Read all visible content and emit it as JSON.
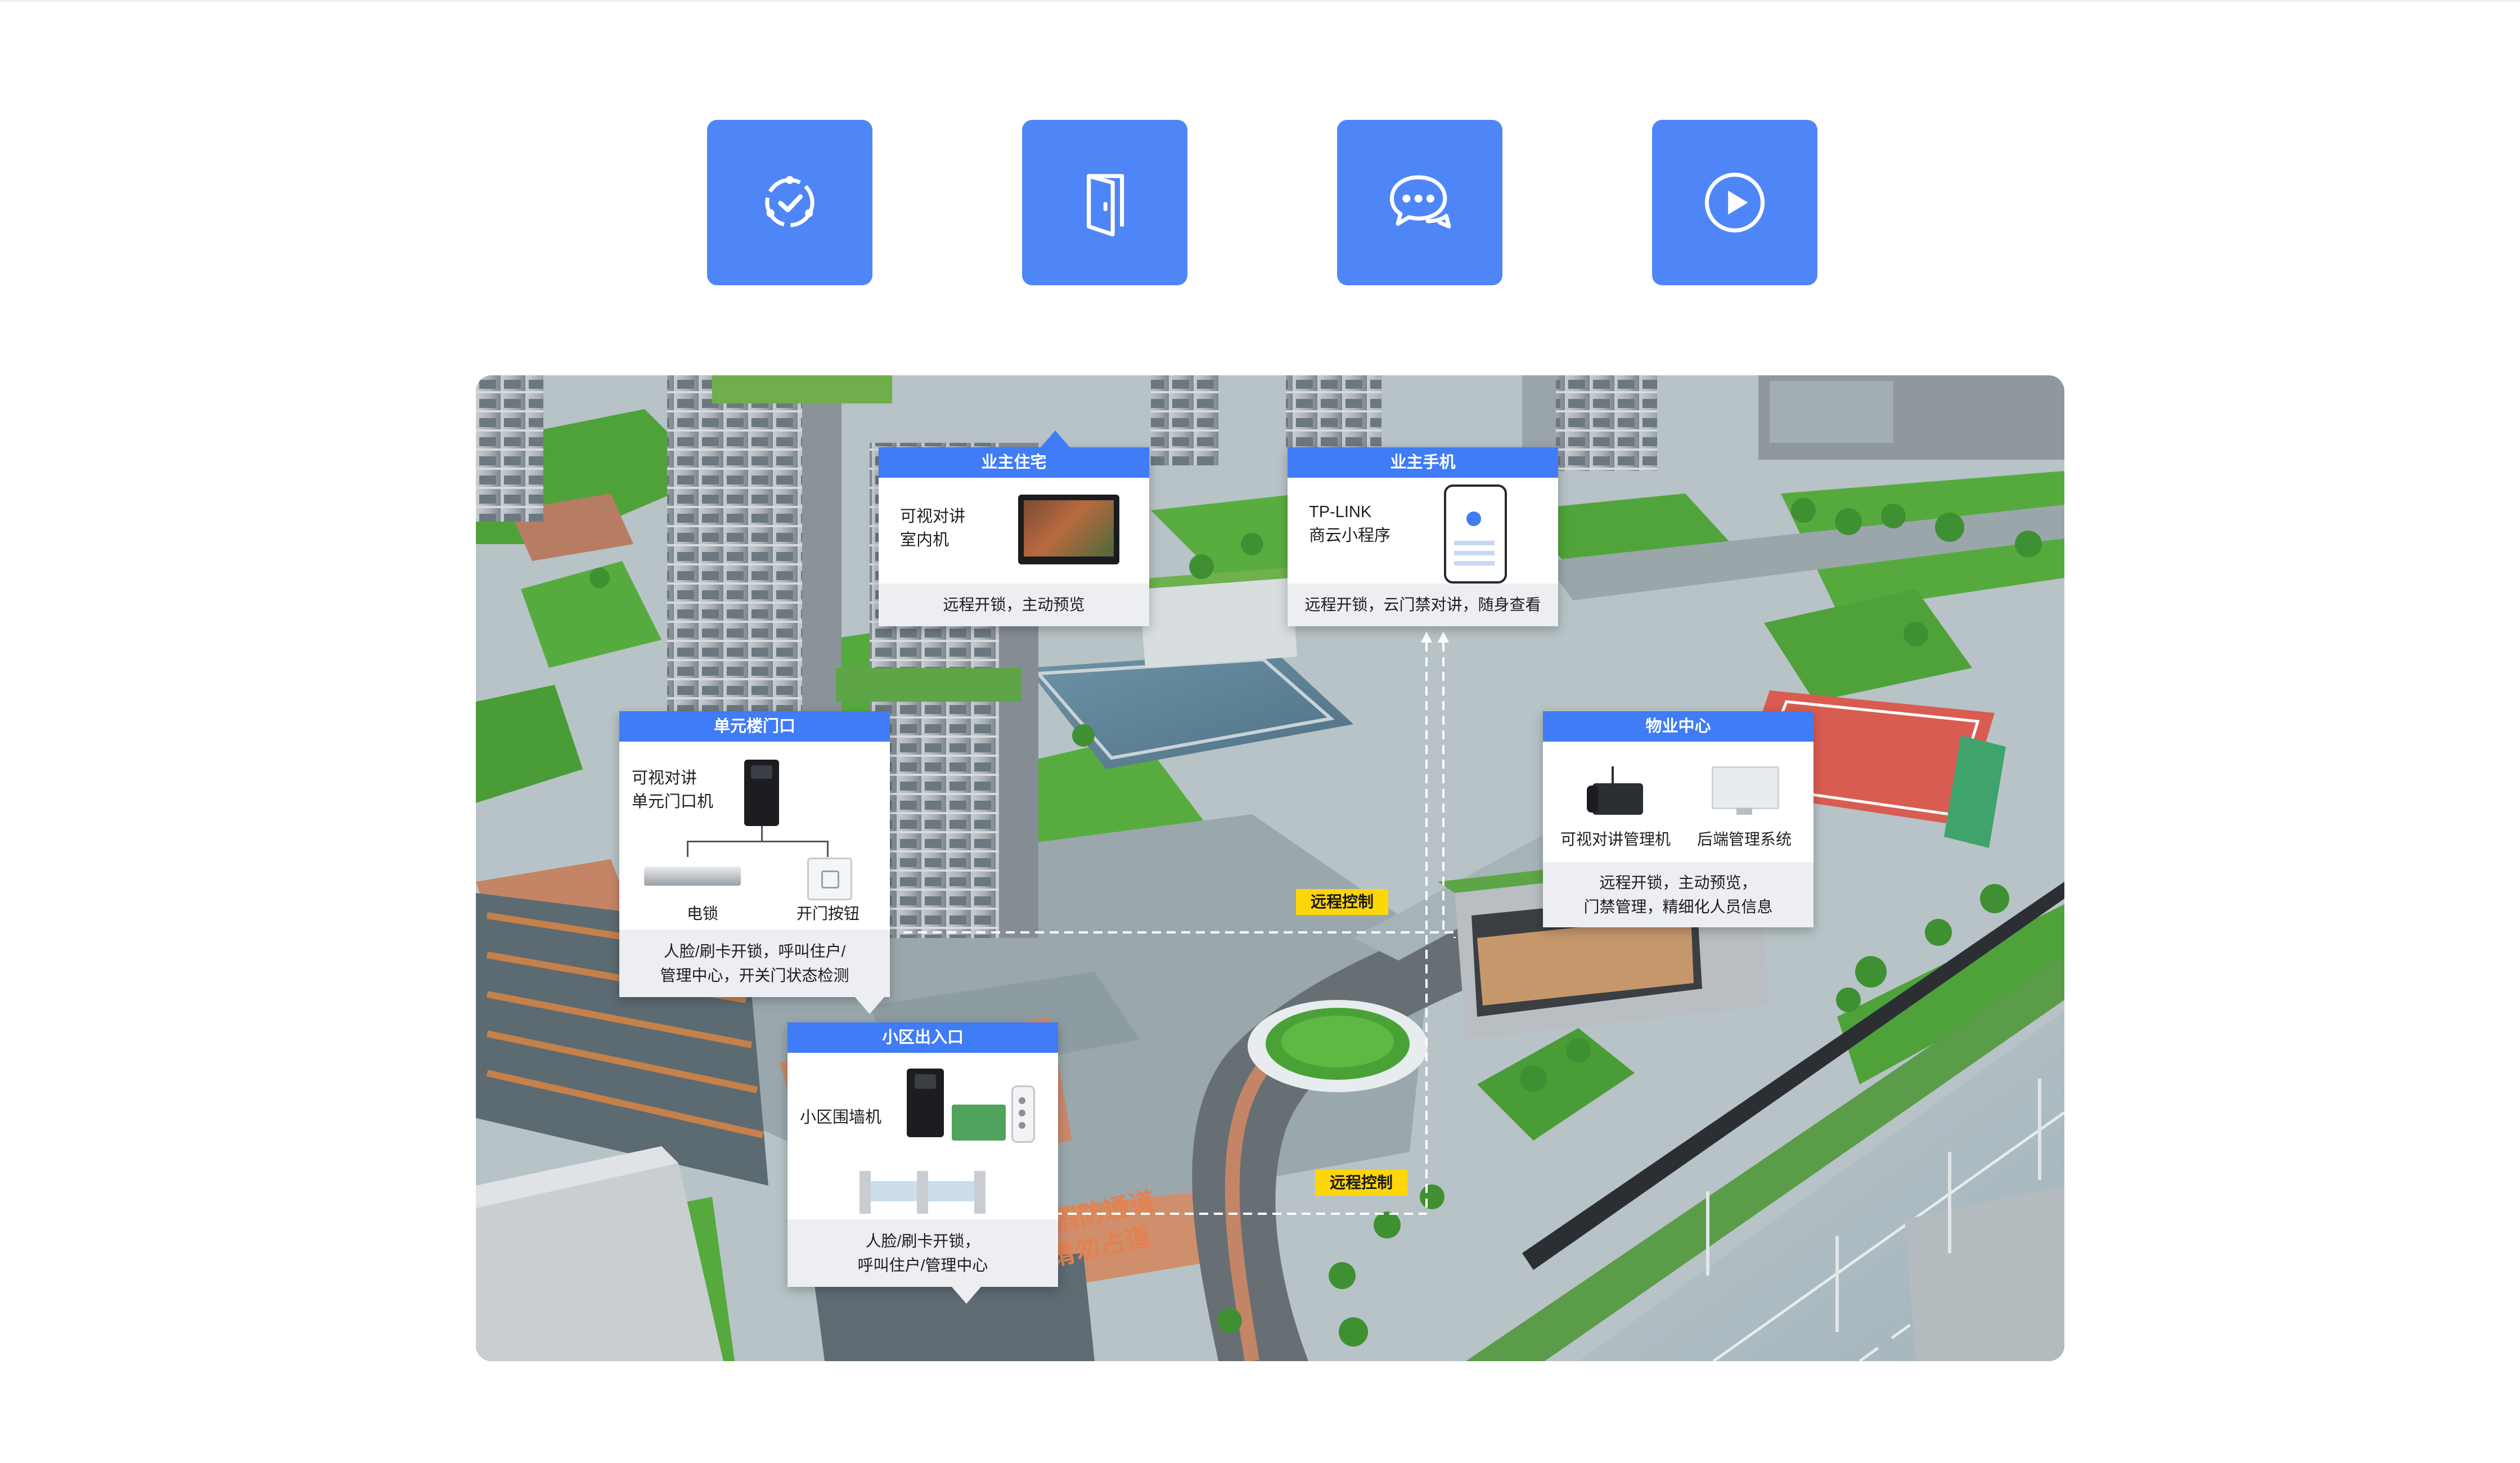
{
  "features": [
    {
      "icon": "check-cycle-icon"
    },
    {
      "icon": "door-icon"
    },
    {
      "icon": "chat-bubble-icon"
    },
    {
      "icon": "play-icon"
    }
  ],
  "colors": {
    "accent": "#4f86f7",
    "panel_header": "#3f7cf5",
    "badge": "#ffd60a",
    "panel_footer": "#eceef2"
  },
  "panels": {
    "owner_home": {
      "title": "业主住宅",
      "device_line1": "可视对讲",
      "device_line2": "室内机",
      "caption": "远程开锁，主动预览"
    },
    "owner_phone": {
      "title": "业主手机",
      "device_line1": "TP-LINK",
      "device_line2": "商云小程序",
      "caption": "远程开锁，云门禁对讲，随身查看"
    },
    "unit_entrance": {
      "title": "单元楼门口",
      "device_line1": "可视对讲",
      "device_line2": "单元门口机",
      "lock_label": "电锁",
      "button_label": "开门按钮",
      "caption_line1": "人脸/刷卡开锁，呼叫住户/",
      "caption_line2": "管理中心，开关门状态检测"
    },
    "property_center": {
      "title": "物业中心",
      "device1_label": "可视对讲管理机",
      "device2_label": "后端管理系统",
      "caption_line1": "远程开锁，主动预览，",
      "caption_line2": "门禁管理，精细化人员信息"
    },
    "community_gate": {
      "title": "小区出入口",
      "device_label": "小区围墙机",
      "caption_line1": "人脸/刷卡开锁，",
      "caption_line2": "呼叫住户/管理中心"
    }
  },
  "badges": {
    "remote_control_1": "远程控制",
    "remote_control_2": "远程控制"
  },
  "ground_markings": {
    "line1": "消防通道",
    "line2": "请勿占道"
  }
}
